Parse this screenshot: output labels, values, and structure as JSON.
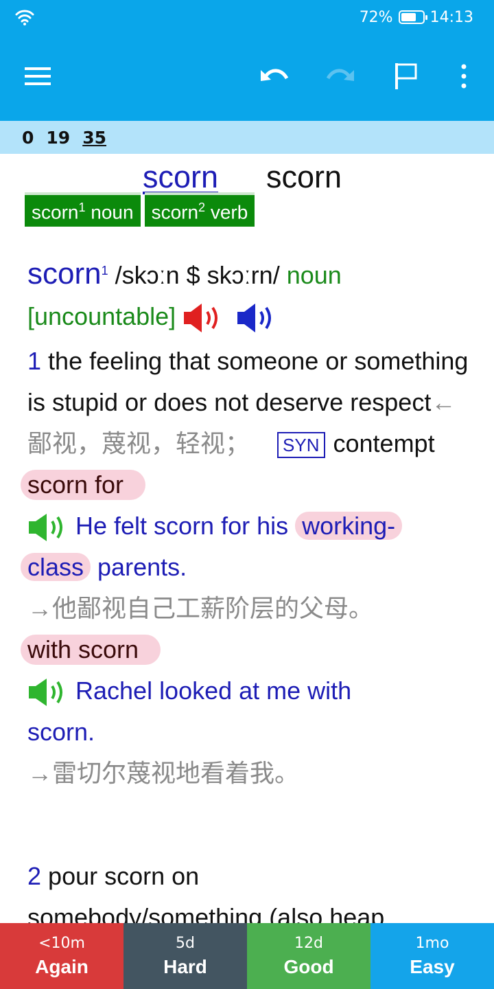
{
  "status": {
    "battery": "72%",
    "time": "14:13",
    "battery_level": 0.72
  },
  "counts": {
    "new": "0",
    "learning": "19",
    "due": "35"
  },
  "header": {
    "link_word": "scorn",
    "plain_word": "scorn"
  },
  "entries": [
    {
      "word": "scorn",
      "sup": "1",
      "pos": "noun"
    },
    {
      "word": "scorn",
      "sup": "2",
      "pos": "verb"
    }
  ],
  "def": {
    "headword": "scorn",
    "sup": "1",
    "pron": "/skɔːn $ skɔːrn/",
    "pos": "noun",
    "gram": "[uncountable]",
    "sense1": {
      "num": "1",
      "text": "the feeling that someone or something is stupid or does not deserve respect",
      "cn": "←鄙视，蔑视，轻视；",
      "syn_label": "SYN",
      "syn_word": "contempt",
      "coll1": "scorn for",
      "ex1_a": "He felt scorn for his ",
      "ex1_hl1": "working-",
      "ex1_hl2": "class",
      "ex1_b": " parents.",
      "ex1_cn": "→他鄙视自己工薪阶层的父母。",
      "coll2": "with scorn",
      "ex2_a": "Rachel looked at me with",
      "ex2_b": "scorn.",
      "ex2_cn": "→雷切尔蔑视地看着我。"
    },
    "sense2": {
      "num": "2",
      "line1": "pour scorn on",
      "line2": "somebody/something (also heap"
    }
  },
  "answers": [
    {
      "time": "<10m",
      "label": "Again",
      "color": "#d83a3a"
    },
    {
      "time": "5d",
      "label": "Hard",
      "color": "#435561"
    },
    {
      "time": "12d",
      "label": "Good",
      "color": "#4caf50"
    },
    {
      "time": "1mo",
      "label": "Easy",
      "color": "#14a4ea"
    }
  ]
}
